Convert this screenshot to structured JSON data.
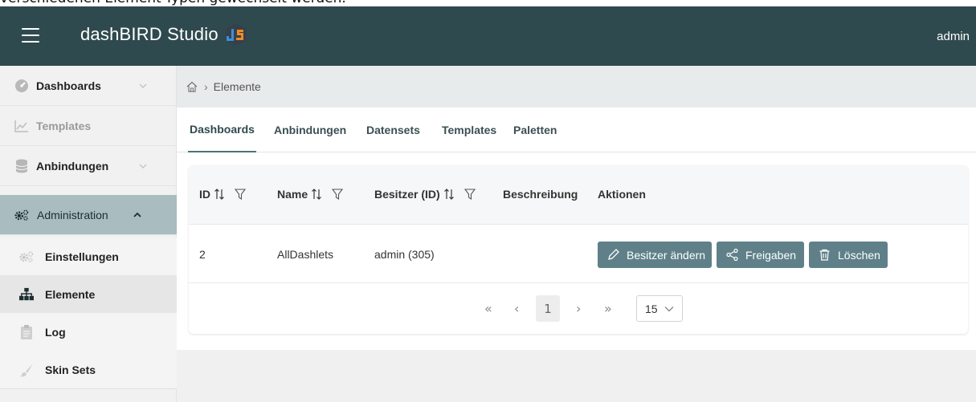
{
  "caption": "verschiedenen Element-Typen gewechselt werden.",
  "header": {
    "brand": "dashBIRD Studio",
    "user": "admin"
  },
  "sidebar": {
    "items": [
      {
        "label": "Dashboards",
        "icon": "dashboard-icon"
      },
      {
        "label": "Templates",
        "icon": "chart-icon"
      },
      {
        "label": "Anbindungen",
        "icon": "database-icon"
      },
      {
        "label": "Administration",
        "icon": "gears-icon"
      },
      {
        "label": "Einstellungen",
        "icon": "gears-icon"
      },
      {
        "label": "Elemente",
        "icon": "sitemap-icon"
      },
      {
        "label": "Log",
        "icon": "clipboard-icon"
      },
      {
        "label": "Skin Sets",
        "icon": "brush-icon"
      }
    ]
  },
  "breadcrumb": {
    "current": "Elemente"
  },
  "tabs": [
    "Dashboards",
    "Anbindungen",
    "Datensets",
    "Templates",
    "Paletten"
  ],
  "table": {
    "columns": [
      "ID",
      "Name",
      "Besitzer (ID)",
      "Beschreibung",
      "Aktionen"
    ],
    "rows": [
      {
        "id": "2",
        "name": "AllDashlets",
        "owner": "admin (305)",
        "description": ""
      }
    ],
    "actions": {
      "change_owner": "Besitzer ändern",
      "shares": "Freigaben",
      "delete": "Löschen"
    }
  },
  "pagination": {
    "first": "«",
    "prev": "‹",
    "page": "1",
    "next": "›",
    "last": "»",
    "page_size": "15"
  },
  "colors": {
    "header_bg": "#2f4a4e",
    "active_nav_bg": "#a9bcc0",
    "button_bg": "#5f8089"
  }
}
